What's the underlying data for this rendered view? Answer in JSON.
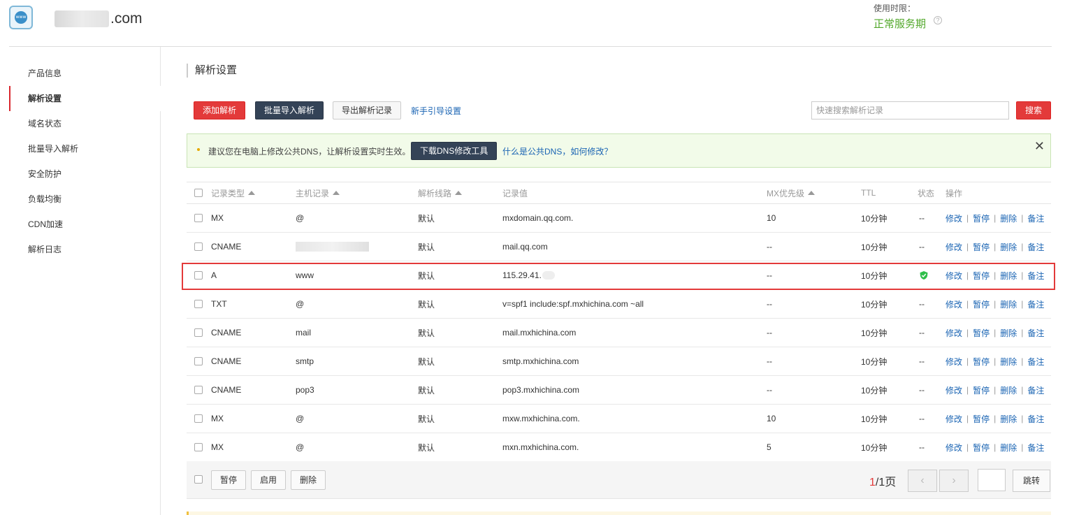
{
  "header": {
    "logo_text": "www",
    "domain_suffix": ".com",
    "period_label": "使用时限：",
    "period_value": "正常服务期",
    "help_glyph": "?"
  },
  "sidebar": {
    "items": [
      {
        "label": "产品信息"
      },
      {
        "label": "解析设置"
      },
      {
        "label": "域名状态"
      },
      {
        "label": "批量导入解析"
      },
      {
        "label": "安全防护"
      },
      {
        "label": "负载均衡"
      },
      {
        "label": "CDN加速"
      },
      {
        "label": "解析日志"
      }
    ],
    "active_item": "解析设置"
  },
  "main": {
    "title": "解析设置",
    "toolbar": {
      "add": "添加解析",
      "batch_import": "批量导入解析",
      "export": "导出解析记录",
      "guide": "新手引导设置",
      "search_placeholder": "快速搜索解析记录",
      "search_button": "搜索"
    },
    "notice": {
      "text": "建议您在电脑上修改公共DNS，让解析设置实时生效。",
      "download_button": "下载DNS修改工具",
      "link": "什么是公共DNS，如何修改？",
      "close": "✕"
    },
    "table": {
      "headers": {
        "type": "记录类型",
        "host": "主机记录",
        "line": "解析线路",
        "value": "记录值",
        "mx": "MX优先级",
        "ttl": "TTL",
        "status": "状态",
        "ops": "操作"
      },
      "ops": {
        "edit": "修改",
        "pause": "暂停",
        "delete": "删除",
        "note": "备注",
        "sep": "|"
      },
      "rows": [
        {
          "type": "MX",
          "host": "@",
          "line": "默认",
          "value": "mxdomain.qq.com.",
          "mx": "10",
          "ttl": "10分钟",
          "status": "--"
        },
        {
          "type": "CNAME",
          "host": "",
          "line": "默认",
          "value": "mail.qq.com",
          "mx": "--",
          "ttl": "10分钟",
          "status": "--"
        },
        {
          "type": "A",
          "host": "www",
          "line": "默认",
          "value": "115.29.41.",
          "mx": "--",
          "ttl": "10分钟",
          "status": ""
        },
        {
          "type": "TXT",
          "host": "@",
          "line": "默认",
          "value": "v=spf1 include:spf.mxhichina.com ~all",
          "mx": "--",
          "ttl": "10分钟",
          "status": "--"
        },
        {
          "type": "CNAME",
          "host": "mail",
          "line": "默认",
          "value": "mail.mxhichina.com",
          "mx": "--",
          "ttl": "10分钟",
          "status": "--"
        },
        {
          "type": "CNAME",
          "host": "smtp",
          "line": "默认",
          "value": "smtp.mxhichina.com",
          "mx": "--",
          "ttl": "10分钟",
          "status": "--"
        },
        {
          "type": "CNAME",
          "host": "pop3",
          "line": "默认",
          "value": "pop3.mxhichina.com",
          "mx": "--",
          "ttl": "10分钟",
          "status": "--"
        },
        {
          "type": "MX",
          "host": "@",
          "line": "默认",
          "value": "mxw.mxhichina.com.",
          "mx": "10",
          "ttl": "10分钟",
          "status": "--"
        },
        {
          "type": "MX",
          "host": "@",
          "line": "默认",
          "value": "mxn.mxhichina.com.",
          "mx": "5",
          "ttl": "10分钟",
          "status": "--"
        }
      ]
    },
    "bulk": {
      "pause": "暂停",
      "enable": "启用",
      "delete": "删除"
    },
    "pager": {
      "current": "1",
      "total_text": "/1页",
      "prev": "‹",
      "next": "›",
      "jump": "跳转"
    }
  },
  "colors": {
    "accent_red": "#e33a3a",
    "dark_button": "#344357",
    "link_blue": "#1a64b3",
    "status_green": "#52a82b"
  }
}
